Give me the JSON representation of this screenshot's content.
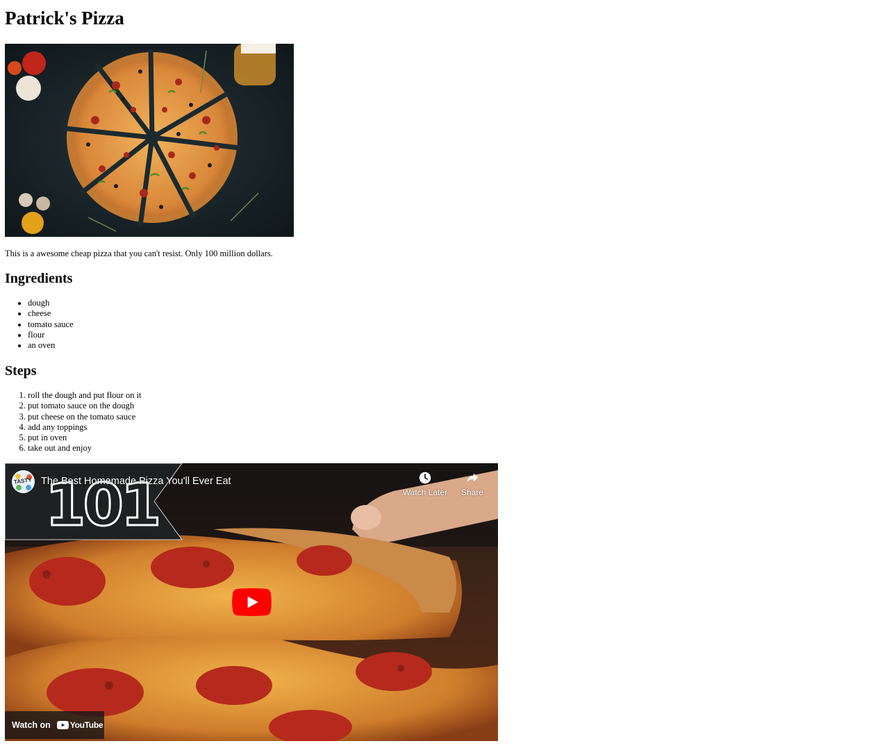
{
  "page": {
    "title": "Patrick's Pizza",
    "description": "This is a awesome cheap pizza that you can't resist. Only 100 million dollars."
  },
  "ingredients": {
    "heading": "Ingredients",
    "items": [
      "dough",
      "cheese",
      "tomato sauce",
      "flour",
      "an oven"
    ]
  },
  "steps": {
    "heading": "Steps",
    "items": [
      "roll the dough and put flour on it",
      "put tomato sauce on the dough",
      "put cheese on the tomato sauce",
      "add any toppings",
      "put in oven",
      "take out and enjoy"
    ]
  },
  "video": {
    "title": "The Best Homemade Pizza You'll Ever Eat",
    "watch_later_label": "Watch Later",
    "share_label": "Share",
    "watch_on_label": "Watch on",
    "youtube_label": "YouTube",
    "thumbnail_banner_text": "101",
    "channel_avatar_text": "TASTY"
  },
  "colors": {
    "youtube_red": "#ff0000",
    "chalkboard": "#1f2021",
    "pizza_crust": "#c9873a",
    "pepperoni": "#b52a1c"
  }
}
